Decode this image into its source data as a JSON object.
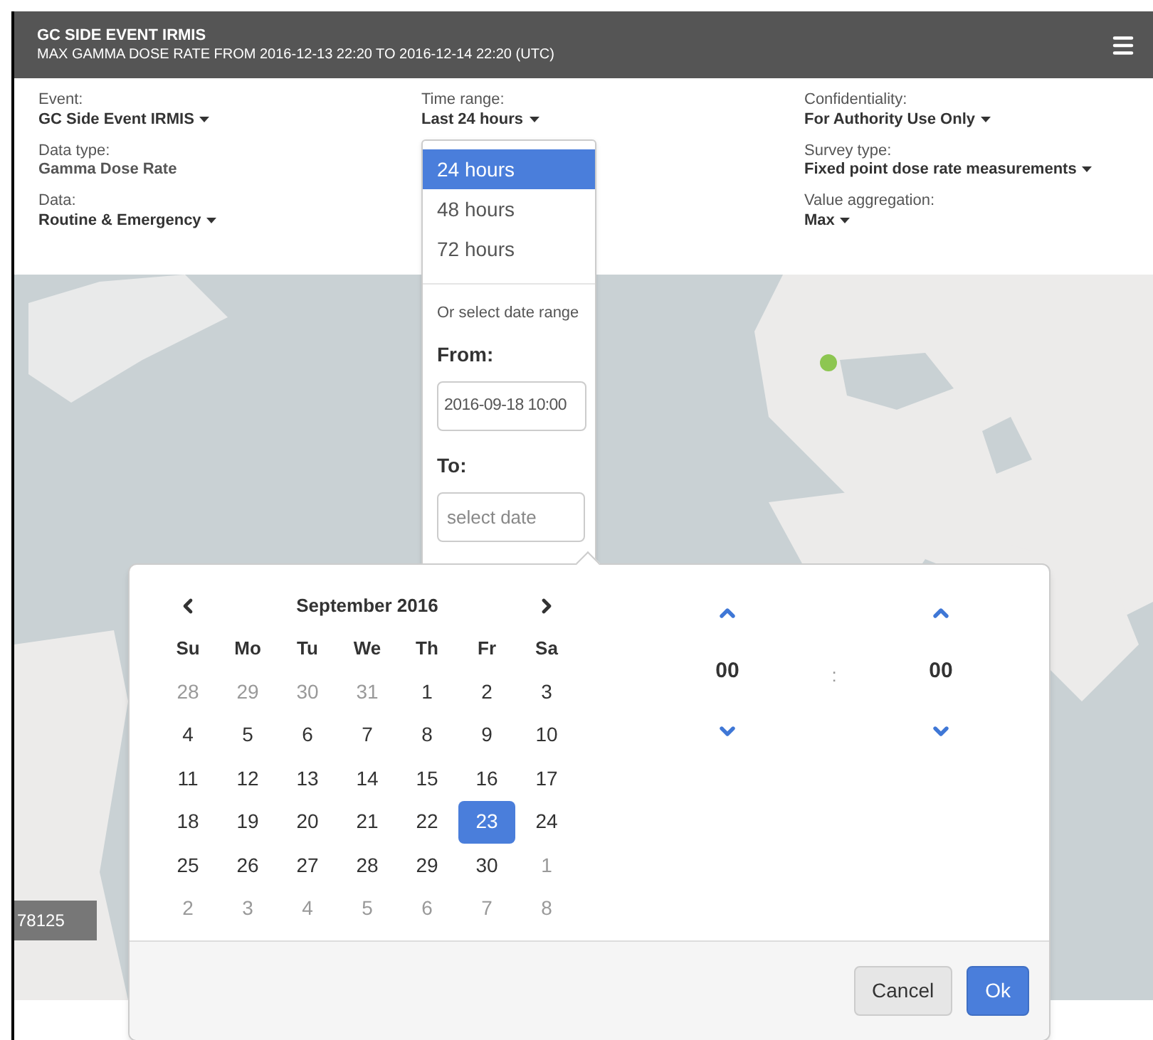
{
  "header": {
    "title": "GC SIDE EVENT IRMIS",
    "subtitle": "MAX GAMMA DOSE RATE FROM 2016-12-13 22:20 TO 2016-12-14 22:20 (UTC)"
  },
  "filter_columns": [
    [
      {
        "label": "Event:",
        "value": "GC Side Event IRMIS",
        "has_menu": true
      },
      {
        "label": "Data type:",
        "value": "Gamma Dose Rate",
        "has_menu": false
      },
      {
        "label": "Data:",
        "value": "Routine & Emergency",
        "has_menu": true
      }
    ],
    [
      {
        "label": "Time range:",
        "value": "Last 24 hours",
        "has_menu": true
      }
    ],
    [
      {
        "label": "Confidentiality:",
        "value": "For Authority Use Only",
        "has_menu": true
      },
      {
        "label": "Survey type:",
        "value": "Fixed point dose rate measurements",
        "has_menu": true
      },
      {
        "label": "Value aggregation:",
        "value": "Max",
        "has_menu": true
      }
    ]
  ],
  "map": {
    "legend_label": "78125"
  },
  "time_range_menu": {
    "options": [
      {
        "label": "24 hours",
        "selected": true
      },
      {
        "label": "48 hours",
        "selected": false
      },
      {
        "label": "72 hours",
        "selected": false
      }
    ],
    "range_hint": "Or select date range",
    "from_label": "From:",
    "from_value": "2016-09-18 10:00",
    "to_label": "To:",
    "to_placeholder": "select date"
  },
  "date_picker": {
    "month_title": "September 2016",
    "weekdays": [
      "Su",
      "Mo",
      "Tu",
      "We",
      "Th",
      "Fr",
      "Sa"
    ],
    "weeks": [
      [
        {
          "day": "28",
          "other_month": true,
          "selected": false
        },
        {
          "day": "29",
          "other_month": true,
          "selected": false
        },
        {
          "day": "30",
          "other_month": true,
          "selected": false
        },
        {
          "day": "31",
          "other_month": true,
          "selected": false
        },
        {
          "day": "1",
          "other_month": false,
          "selected": false
        },
        {
          "day": "2",
          "other_month": false,
          "selected": false
        },
        {
          "day": "3",
          "other_month": false,
          "selected": false
        }
      ],
      [
        {
          "day": "4",
          "other_month": false,
          "selected": false
        },
        {
          "day": "5",
          "other_month": false,
          "selected": false
        },
        {
          "day": "6",
          "other_month": false,
          "selected": false
        },
        {
          "day": "7",
          "other_month": false,
          "selected": false
        },
        {
          "day": "8",
          "other_month": false,
          "selected": false
        },
        {
          "day": "9",
          "other_month": false,
          "selected": false
        },
        {
          "day": "10",
          "other_month": false,
          "selected": false
        }
      ],
      [
        {
          "day": "11",
          "other_month": false,
          "selected": false
        },
        {
          "day": "12",
          "other_month": false,
          "selected": false
        },
        {
          "day": "13",
          "other_month": false,
          "selected": false
        },
        {
          "day": "14",
          "other_month": false,
          "selected": false
        },
        {
          "day": "15",
          "other_month": false,
          "selected": false
        },
        {
          "day": "16",
          "other_month": false,
          "selected": false
        },
        {
          "day": "17",
          "other_month": false,
          "selected": false
        }
      ],
      [
        {
          "day": "18",
          "other_month": false,
          "selected": false
        },
        {
          "day": "19",
          "other_month": false,
          "selected": false
        },
        {
          "day": "20",
          "other_month": false,
          "selected": false
        },
        {
          "day": "21",
          "other_month": false,
          "selected": false
        },
        {
          "day": "22",
          "other_month": false,
          "selected": false
        },
        {
          "day": "23",
          "other_month": false,
          "selected": true
        },
        {
          "day": "24",
          "other_month": false,
          "selected": false
        }
      ],
      [
        {
          "day": "25",
          "other_month": false,
          "selected": false
        },
        {
          "day": "26",
          "other_month": false,
          "selected": false
        },
        {
          "day": "27",
          "other_month": false,
          "selected": false
        },
        {
          "day": "28",
          "other_month": false,
          "selected": false
        },
        {
          "day": "29",
          "other_month": false,
          "selected": false
        },
        {
          "day": "30",
          "other_month": false,
          "selected": false
        },
        {
          "day": "1",
          "other_month": true,
          "selected": false
        }
      ],
      [
        {
          "day": "2",
          "other_month": true,
          "selected": false
        },
        {
          "day": "3",
          "other_month": true,
          "selected": false
        },
        {
          "day": "4",
          "other_month": true,
          "selected": false
        },
        {
          "day": "5",
          "other_month": true,
          "selected": false
        },
        {
          "day": "6",
          "other_month": true,
          "selected": false
        },
        {
          "day": "7",
          "other_month": true,
          "selected": false
        },
        {
          "day": "8",
          "other_month": true,
          "selected": false
        }
      ]
    ],
    "time": {
      "hours": "00",
      "separator": ":",
      "minutes": "00"
    },
    "buttons": {
      "cancel": "Cancel",
      "ok": "Ok"
    }
  }
}
